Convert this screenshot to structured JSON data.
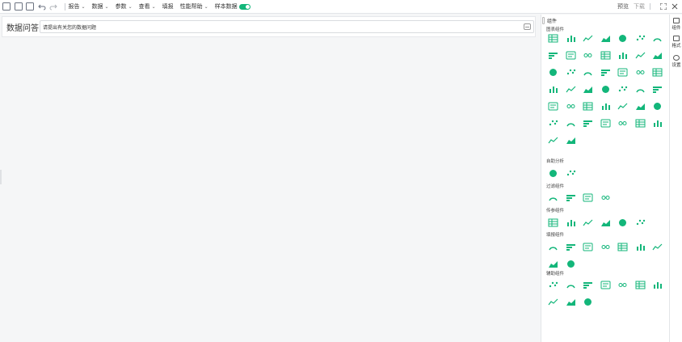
{
  "toolbar": {
    "menus": [
      {
        "label": "报告"
      },
      {
        "label": "数据"
      },
      {
        "label": "参数"
      },
      {
        "label": "查看"
      },
      {
        "label": "填报"
      },
      {
        "label": "性能帮助"
      }
    ],
    "sample_data_label": "样本数据",
    "sample_data_on": true,
    "preview_label": "预览",
    "download_label": "下载"
  },
  "qa": {
    "title": "数据问答",
    "placeholder": "请提出有关您的数据问题"
  },
  "panel": {
    "title": "组件",
    "sections": [
      {
        "title": "图表组件",
        "icons": [
          "table-icon",
          "pivot-table-icon",
          "detail-table-icon",
          "bar-chart-icon",
          "grouped-bar-icon",
          "stacked-bar-icon",
          "percent-bar-icon",
          "line-chart-icon",
          "multi-line-icon",
          "area-chart-icon",
          "stacked-area-icon",
          "pie-chart-icon",
          "donut-chart-icon",
          "ring-chart-icon",
          "rose-chart-icon",
          "radial-icon",
          "scatter-icon",
          "bubble-scatter-icon",
          "bubble-chart-icon",
          "waterfall-icon",
          "kpi-number-icon",
          "gauge-icon",
          "funnel-icon",
          "map-icon",
          "heat-map-icon",
          "radar-icon",
          "polar-icon",
          "trend-icon",
          "bar-combo-icon",
          "histogram-icon",
          "boxplot-icon",
          "treemap-icon",
          "network-icon",
          "sankey-icon",
          "word-cloud-icon",
          "bullet-icon",
          "gantt-icon",
          "list-icon",
          "geo-bubble-icon",
          "sunburst-icon",
          "candlestick-icon",
          "custom-chart-icon",
          "js-chart-icon",
          "path-chart-icon"
        ]
      },
      {
        "title": "自助分析",
        "icons": [
          "ai-insight-icon",
          "qa-chat-icon"
        ]
      },
      {
        "title": "过滤组件",
        "icons": [
          "list-filter-icon",
          "tree-filter-icon",
          "range-filter-icon",
          "date-filter-icon"
        ]
      },
      {
        "title": "传参组件",
        "icons": [
          "param-list-icon",
          "param-tree-icon",
          "param-input-icon",
          "param-text-icon",
          "param-link-icon",
          "param-select-icon"
        ]
      },
      {
        "title": "填报组件",
        "icons": [
          "form-table-icon",
          "form-detail-icon",
          "form-list-icon",
          "form-tree-icon",
          "form-input-icon",
          "form-text-icon",
          "form-select-icon",
          "upload-icon",
          "form-date-icon"
        ]
      },
      {
        "title": "辅助组件",
        "icons": [
          "text-icon",
          "image-icon",
          "web-icon",
          "tab-icon",
          "iframe-icon",
          "frame-icon",
          "container-icon",
          "timer-icon",
          "button-icon",
          "puzzle-icon"
        ]
      }
    ]
  },
  "rail": {
    "items": [
      {
        "label": "组件"
      },
      {
        "label": "格式"
      },
      {
        "label": "设置"
      }
    ]
  },
  "colors": {
    "accent": "#13b67a"
  }
}
